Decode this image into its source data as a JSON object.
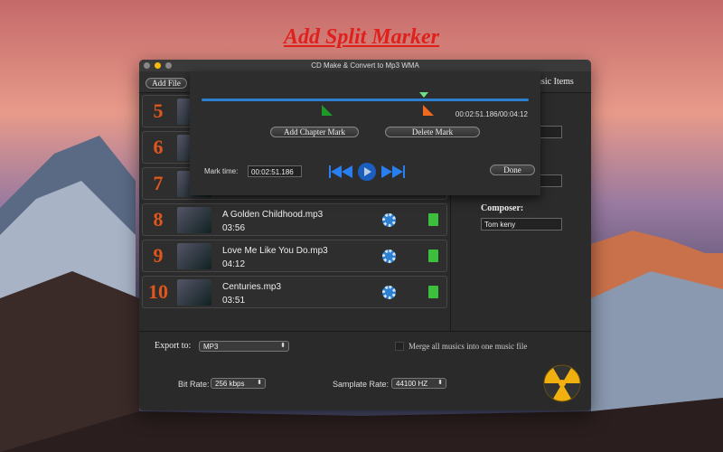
{
  "promo_title": "Add Split Marker",
  "window": {
    "title": "CD Make & Convert to Mp3 WMA"
  },
  "toolbar": {
    "add_file": "Add File",
    "music_items": "usic Items"
  },
  "tracks": [
    {
      "num": "5",
      "name": "",
      "duration": ""
    },
    {
      "num": "6",
      "name": "",
      "duration": ""
    },
    {
      "num": "7",
      "name": "",
      "duration": ""
    },
    {
      "num": "8",
      "name": "A Golden Childhood.mp3",
      "duration": "03:56"
    },
    {
      "num": "9",
      "name": "Love Me Like You Do.mp3",
      "duration": "04:12"
    },
    {
      "num": "10",
      "name": "Centuries.mp3",
      "duration": "03:51"
    }
  ],
  "details": {
    "composer_label": "Composer:",
    "composer_value": "Tom keny"
  },
  "sheet": {
    "time_readout": "00:02:51.186/00:04:12",
    "add_chapter": "Add Chapter Mark",
    "delete_mark": "Delete Mark",
    "mark_time_label": "Mark time:",
    "mark_time_value": "00:02:51.186",
    "done": "Done",
    "playhead_fraction": 0.68
  },
  "export": {
    "export_label": "Export to:",
    "format": "MP3",
    "merge_label": "Merge all musics into one music file",
    "merge_checked": false,
    "bitrate_label": "Bit Rate:",
    "bitrate": "256 kbps",
    "samplerate_label": "Samplate Rate:",
    "samplerate": "44100 HZ"
  },
  "colors": {
    "accent": "#2d7fd0",
    "number": "#e0561c",
    "promo": "#e0201c"
  }
}
